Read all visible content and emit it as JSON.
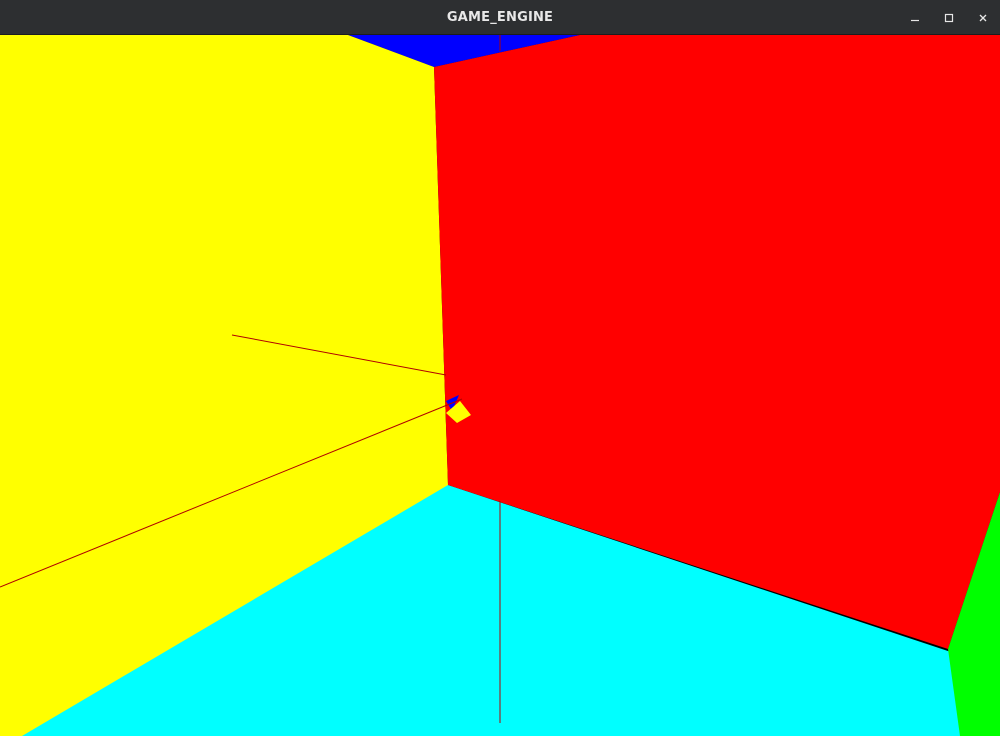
{
  "window": {
    "title": "GAME_ENGINE",
    "controls": {
      "minimize": "minimize-icon",
      "maximize": "maximize-icon",
      "close": "close-icon"
    }
  },
  "scene": {
    "colors": {
      "left_wall": "#ffff00",
      "right_wall": "#ff0000",
      "floor": "#00ffff",
      "ceiling": "#0000ff",
      "side_wall": "#00ff00",
      "line": "#b00000",
      "titlebar": "#2d2f31"
    }
  }
}
